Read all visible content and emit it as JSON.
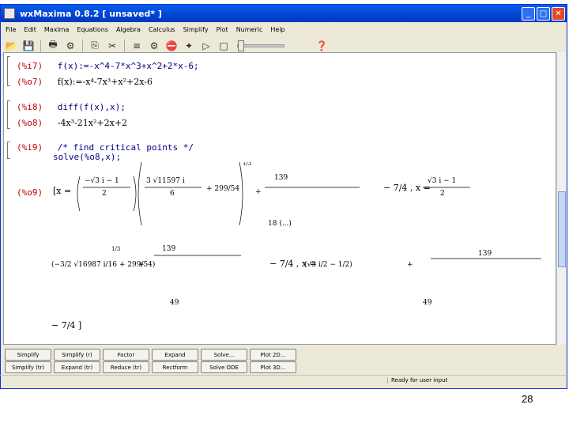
{
  "window": {
    "title": "wxMaxima 0.8.2 [ unsaved* ]"
  },
  "menu": [
    "File",
    "Edit",
    "Maxima",
    "Equations",
    "Algebra",
    "Calculus",
    "Simplify",
    "Plot",
    "Numeric",
    "Help"
  ],
  "worksheet": {
    "cells": [
      {
        "label": "(%i7)",
        "text": "f(x):=-x^4-7*x^3+x^2+2*x-6;",
        "kind": "input"
      },
      {
        "label": "(%o7)",
        "text": "f(x):=-x⁴-7x³+x²+2x-6",
        "kind": "output"
      },
      {
        "label": "(%i8)",
        "text": "diff(f(x),x);",
        "kind": "input"
      },
      {
        "label": "(%o8)",
        "text": "-4x³-21x²+2x+2",
        "kind": "output"
      },
      {
        "label": "(%i9)",
        "text": "/* find critical points */",
        "kind": "input"
      },
      {
        "label": "",
        "text": "solve(%o8,x);",
        "kind": "input"
      },
      {
        "label": "(%o9)",
        "text": "[x = ...]",
        "kind": "output"
      }
    ]
  },
  "buttons": {
    "row1": [
      "Simplify",
      "Simplify (r)",
      "Factor",
      "Expand",
      "Solve...",
      "Plot 2D..."
    ],
    "row2": [
      "Simplify (tr)",
      "Expand (tr)",
      "Reduce (tr)",
      "Rectform",
      "Solve ODE",
      "Plot 3D..."
    ]
  },
  "status": "Ready for user input",
  "page_number": "28"
}
